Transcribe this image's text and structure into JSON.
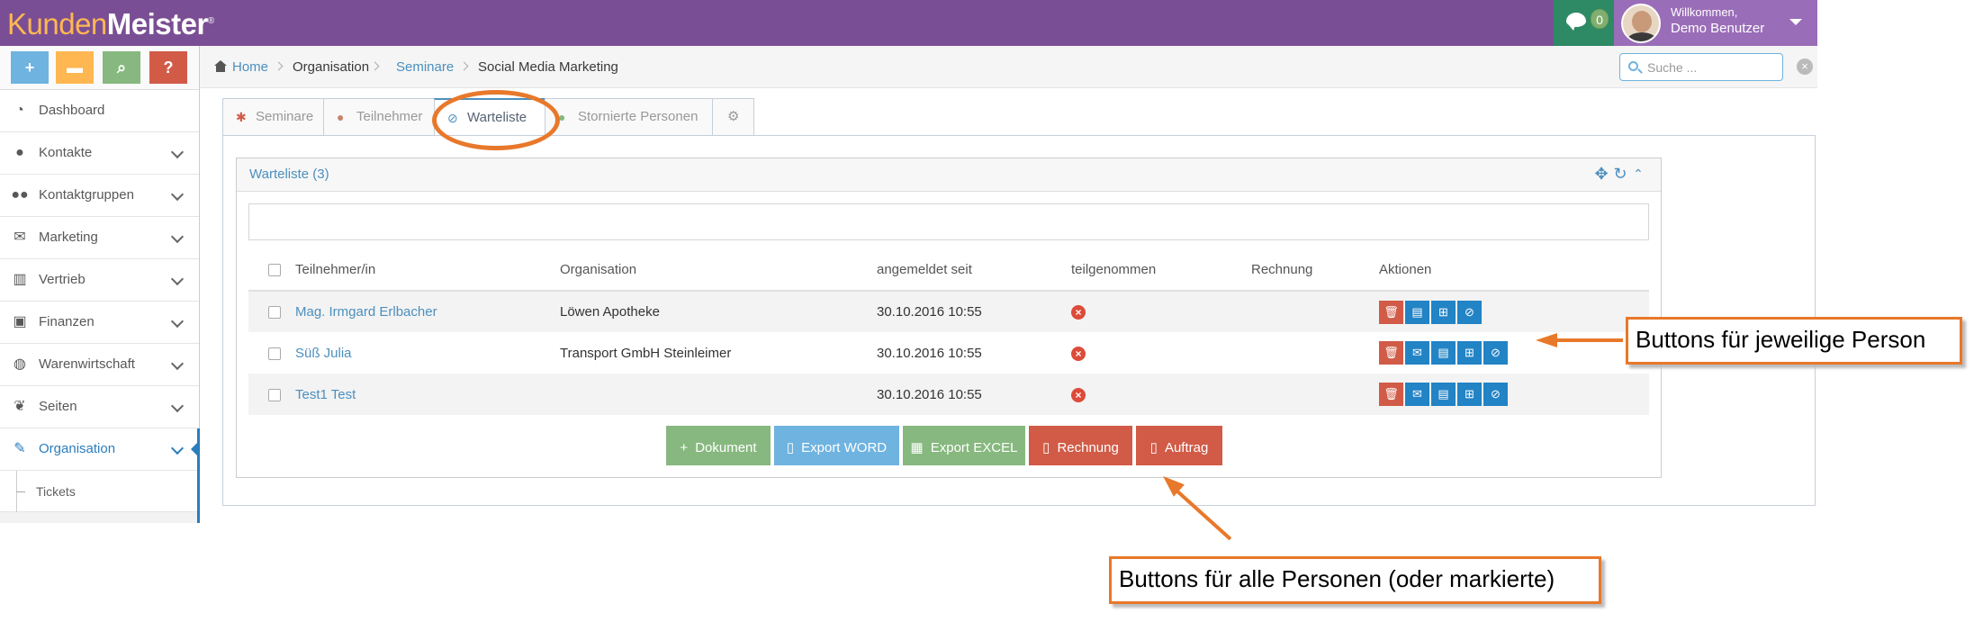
{
  "brand": {
    "part1": "Kunden",
    "part2": "Meister",
    "mark": "®"
  },
  "header": {
    "messages_count": "0",
    "welcome": "Willkommen,",
    "user_name": "Demo Benutzer"
  },
  "shortcuts": [
    "+",
    "▬",
    "⌕",
    "?"
  ],
  "sidebar": {
    "items": [
      {
        "label": "Dashboard",
        "icon": "tachometer-icon"
      },
      {
        "label": "Kontakte",
        "icon": "user-icon"
      },
      {
        "label": "Kontaktgruppen",
        "icon": "users-icon"
      },
      {
        "label": "Marketing",
        "icon": "envelope-icon"
      },
      {
        "label": "Vertrieb",
        "icon": "bar-chart-icon"
      },
      {
        "label": "Finanzen",
        "icon": "money-icon"
      },
      {
        "label": "Warenwirtschaft",
        "icon": "globe-icon"
      },
      {
        "label": "Seiten",
        "icon": "leaf-icon"
      },
      {
        "label": "Organisation",
        "icon": "edit-icon"
      }
    ],
    "sub_items": [
      {
        "label": "Tickets"
      }
    ]
  },
  "breadcrumb": {
    "home": "Home",
    "organisation": "Organisation",
    "seminare": "Seminare",
    "current": "Social Media Marketing"
  },
  "search": {
    "placeholder": "Suche ..."
  },
  "tabs": [
    {
      "label": "Seminare"
    },
    {
      "label": "Teilnehmer"
    },
    {
      "label": "Warteliste"
    },
    {
      "label": "Stornierte Personen"
    },
    {
      "label": ""
    }
  ],
  "widget": {
    "title": "Warteliste (3)"
  },
  "table": {
    "headers": [
      "Teilnehmer/in",
      "Organisation",
      "angemeldet seit",
      "teilgenommen",
      "Rechnung",
      "Aktionen"
    ],
    "rows": [
      {
        "name": "Mag. Irmgard Erlbacher",
        "organisation": "Löwen Apotheke",
        "date": "30.10.2016 10:55",
        "rechnung": ""
      },
      {
        "name": "Süß Julia",
        "organisation": "Transport GmbH Steinleimer",
        "date": "30.10.2016 10:55",
        "rechnung": ""
      },
      {
        "name": "Test1 Test",
        "organisation": "",
        "date": "30.10.2016 10:55",
        "rechnung": ""
      }
    ]
  },
  "buttons": {
    "dokument": "Dokument",
    "export_word": "Export WORD",
    "export_excel": "Export EXCEL",
    "rechnung": "Rechnung",
    "auftrag": "Auftrag"
  },
  "annotations": {
    "per_person": "Buttons für jeweilige Person",
    "all_persons": "Buttons für alle Personen (oder markierte)"
  },
  "colors": {
    "navbar": "#7a4e94",
    "accent_blue": "#4c8fbd",
    "annotation_orange": "#e8782a",
    "btn_green": "#87b87f",
    "btn_lightblue": "#6fb3e0",
    "btn_red": "#d15b47",
    "btn_blue": "#2283c5"
  }
}
